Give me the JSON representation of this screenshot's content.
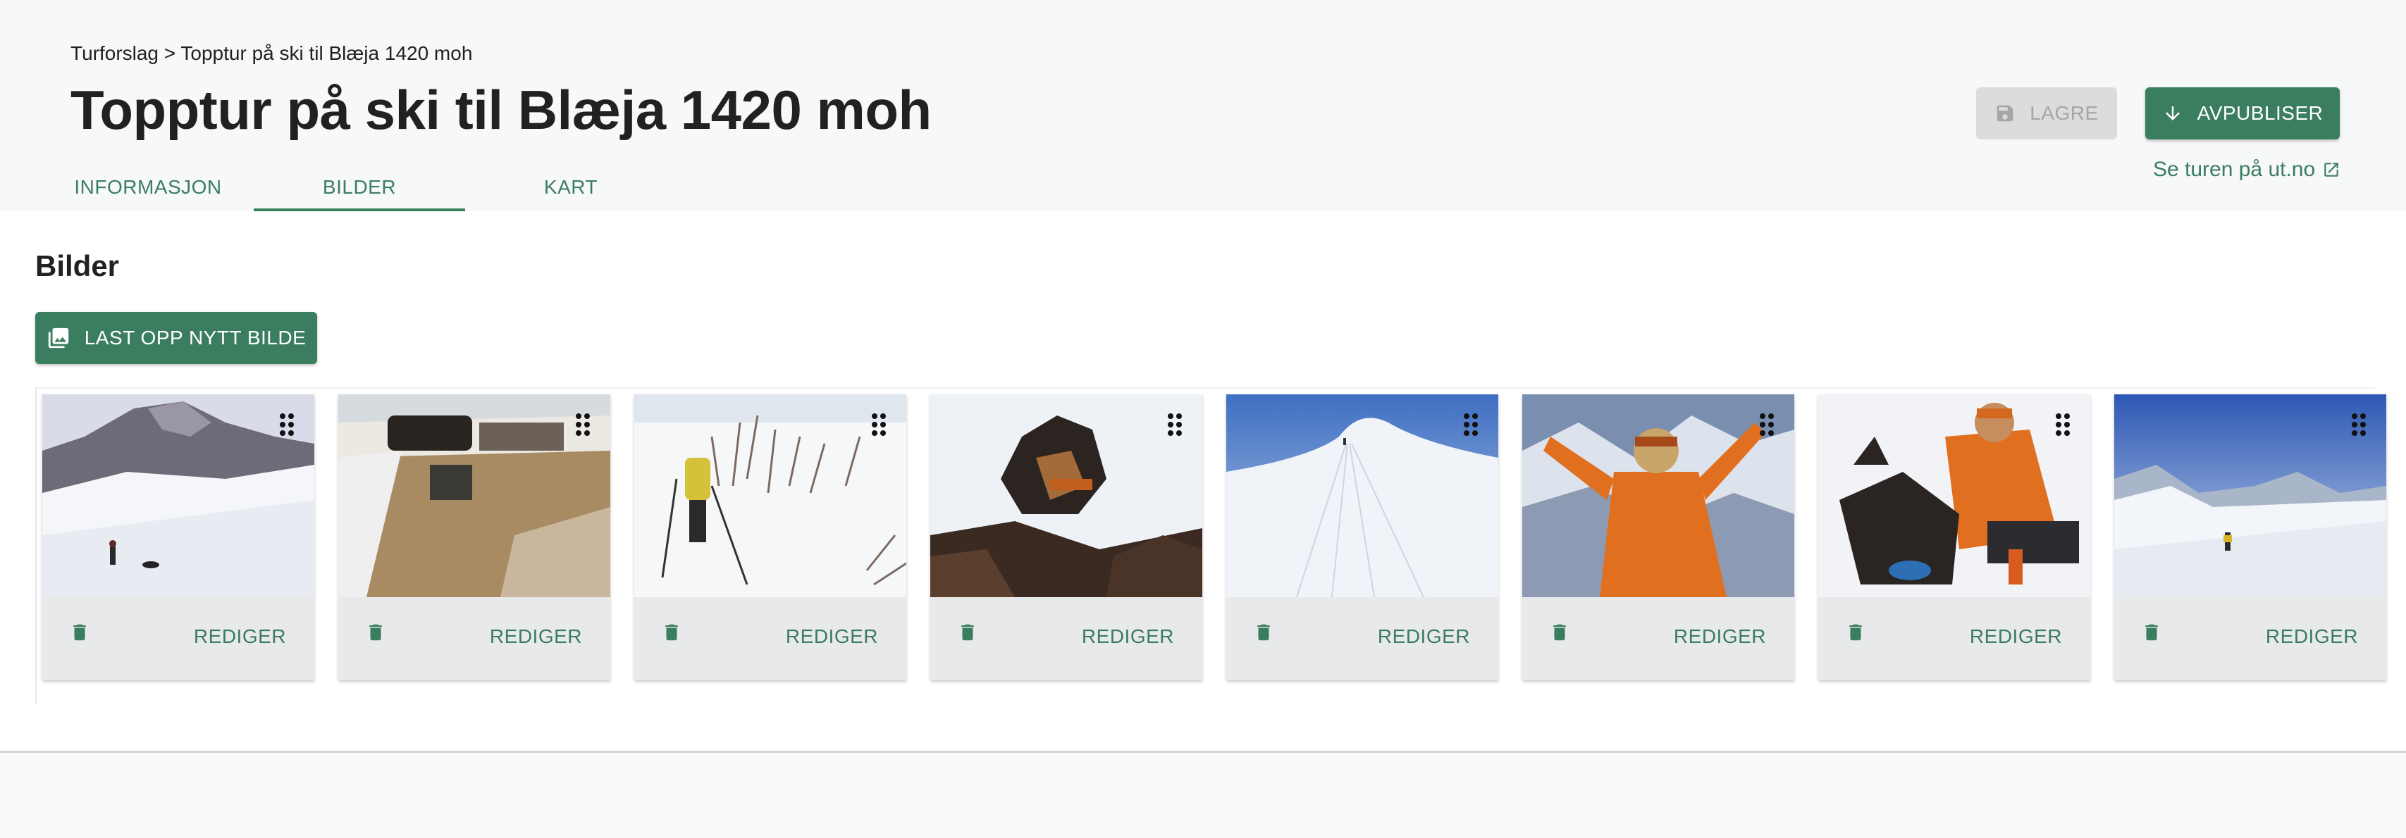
{
  "header": {
    "breadcrumb": "Turforslag > Topptur på ski til Blæja 1420 moh",
    "title": "Topptur på ski til Blæja 1420 moh",
    "save_label": "LAGRE",
    "unpublish_label": "AVPUBLISER",
    "view_link": "Se turen på ut.no"
  },
  "tabs": [
    {
      "label": "INFORMASJON",
      "active": false
    },
    {
      "label": "BILDER",
      "active": true
    },
    {
      "label": "KART",
      "active": false
    }
  ],
  "section": {
    "title": "Bilder",
    "upload_label": "LAST OPP NYTT BILDE"
  },
  "images": [
    {
      "subject": "skier with dog below mountain",
      "edit_label": "REDIGER"
    },
    {
      "subject": "car on gravel parking",
      "edit_label": "REDIGER"
    },
    {
      "subject": "skier among birch trees",
      "edit_label": "REDIGER"
    },
    {
      "subject": "dog lying in snow",
      "edit_label": "REDIGER"
    },
    {
      "subject": "ski tracks toward summit",
      "edit_label": "REDIGER"
    },
    {
      "subject": "person in orange jacket arms raised",
      "edit_label": "REDIGER"
    },
    {
      "subject": "person in orange with dog",
      "edit_label": "REDIGER"
    },
    {
      "subject": "skier on plateau with fjord view",
      "edit_label": "REDIGER"
    }
  ],
  "icons": {
    "save": "floppy-disk-icon",
    "unpublish": "arrow-down-icon",
    "external": "external-link-icon",
    "upload": "photo-library-icon",
    "drag": "drag-handle-icon",
    "delete": "trash-icon"
  },
  "colors": {
    "accent": "#3b7d5f",
    "disabled_bg": "#dcdcdc",
    "card_bg": "#e8e9ea"
  }
}
